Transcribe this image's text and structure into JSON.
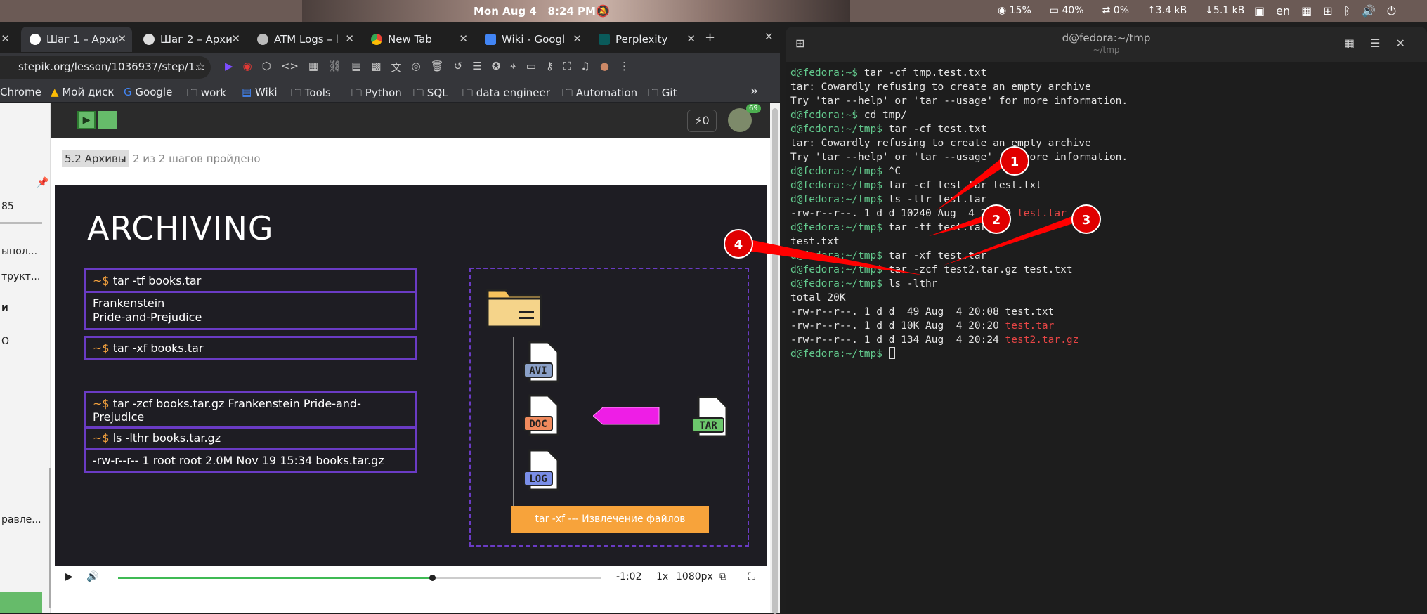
{
  "topbar": {
    "date": "Mon Aug 4",
    "time": "8:24 PM",
    "cpu": "15%",
    "mem": "40%",
    "swap": "0%",
    "up": "3.4 kB",
    "down": "5.1 kB",
    "lang": "en"
  },
  "browser": {
    "tabs": [
      {
        "label": "Шаг 1 – Архи",
        "active": true
      },
      {
        "label": "Шаг 2 – Архи",
        "active": false
      },
      {
        "label": "ATM Logs – l",
        "active": false
      },
      {
        "label": "New Tab",
        "active": false
      },
      {
        "label": "Wiki - Googl",
        "active": false
      },
      {
        "label": "Perplexity",
        "active": false
      }
    ],
    "url": "stepik.org/lesson/1036937/step/1...",
    "bookmarks": [
      "Chrome",
      "Мой диск",
      "Google",
      "work",
      "Wiki",
      "Tools",
      "Python",
      "SQL",
      "data engineer",
      "Automation",
      "Git"
    ]
  },
  "sidebar": {
    "items": [
      "85",
      "ыпол...",
      "трукт...",
      "и",
      "О",
      "равле..."
    ]
  },
  "stepbar": {
    "points": "0",
    "badge": "69"
  },
  "lesson": {
    "section": "5.2 Архивы",
    "progress": "2 из 2 шагов пройдено"
  },
  "video": {
    "title": "ARCHIVING",
    "cmd1": "tar  -tf  books.tar",
    "cmd1_out1": "Frankenstein",
    "cmd1_out2": "Pride-and-Prejudice",
    "cmd2": "tar  -xf  books.tar",
    "cmd3": "tar  -zcf  books.tar.gz  Frankenstein  Pride-and-Prejudice",
    "cmd4": "ls  -lthr  books.tar.gz",
    "cmd4_out": "-rw-r--r-- 1 root root 2.0M Nov 19 15:34 books.tar.gz",
    "prompt": "~$",
    "files": [
      "AVI",
      "DOC",
      "LOG"
    ],
    "archive": "TAR",
    "caption": "tar  -xf  ---  Извлечение файлов",
    "progress": 0.65
  },
  "controls": {
    "remaining": "-1:02",
    "speed": "1x",
    "quality": "1080px"
  },
  "terminal": {
    "title": "d@fedora:~/tmp",
    "subtitle": "~/tmp",
    "lines": [
      {
        "prompt": "d@fedora:~$",
        "text": " tar -cf tmp.test.txt"
      },
      {
        "text": "tar: Cowardly refusing to create an empty archive"
      },
      {
        "text": "Try 'tar --help' or 'tar --usage' for more information."
      },
      {
        "prompt": "d@fedora:~$",
        "text": " cd tmp/"
      },
      {
        "prompt": "d@fedora:~/tmp$",
        "text": " tar -cf test.txt"
      },
      {
        "text": "tar: Cowardly refusing to create an empty archive"
      },
      {
        "text": "Try 'tar --help' or 'tar --usage' for more information."
      },
      {
        "prompt": "d@fedora:~/tmp$",
        "text": " ^C"
      },
      {
        "prompt": "d@fedora:~/tmp$",
        "text": " tar -cf test.tar test.txt"
      },
      {
        "prompt": "d@fedora:~/tmp$",
        "text": " ls -ltr test.tar"
      },
      {
        "text": "-rw-r--r--. 1 d d 10240 Aug  4 20:20 ",
        "red": "test.tar"
      },
      {
        "prompt": "d@fedora:~/tmp$",
        "text": " tar -tf test.tar"
      },
      {
        "text": "test.txt"
      },
      {
        "prompt": "d@fedora:~/tmp$",
        "text": " tar -xf test.tar"
      },
      {
        "prompt": "d@fedora:~/tmp$",
        "text": " tar -zcf test2.tar.gz test.txt"
      },
      {
        "prompt": "d@fedora:~/tmp$",
        "text": " ls -lthr"
      },
      {
        "text": "total 20K"
      },
      {
        "text": "-rw-r--r--. 1 d d  49 Aug  4 20:08 test.txt"
      },
      {
        "text": "-rw-r--r--. 1 d d 10K Aug  4 20:20 ",
        "red": "test.tar"
      },
      {
        "text": "-rw-r--r--. 1 d d 134 Aug  4 20:24 ",
        "red": "test2.tar.gz"
      },
      {
        "prompt": "d@fedora:~/tmp$",
        "text": " ",
        "cursor": true
      }
    ]
  },
  "annotations": [
    "1",
    "2",
    "3",
    "4"
  ],
  "colors": {
    "accent_purple": "#6a3bc4",
    "prompt_green": "#62c88c",
    "archive_red": "#e74545",
    "orange": "#f7a33b"
  }
}
